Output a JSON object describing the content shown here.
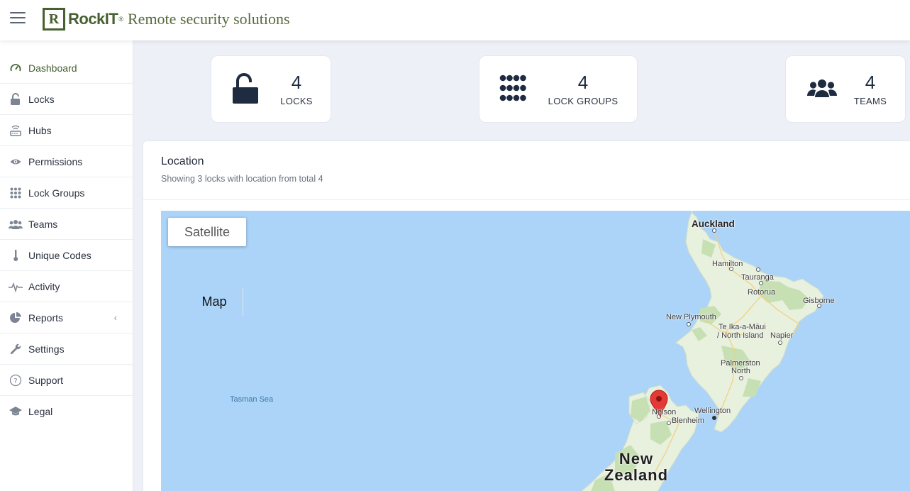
{
  "header": {
    "brand_letter": "R",
    "brand_name": "RockIT",
    "brand_reg": "®",
    "tagline": "Remote security solutions"
  },
  "sidebar": {
    "items": [
      {
        "label": "Dashboard",
        "icon": "speedometer-icon",
        "active": true
      },
      {
        "label": "Locks",
        "icon": "lock-icon"
      },
      {
        "label": "Hubs",
        "icon": "router-icon"
      },
      {
        "label": "Permissions",
        "icon": "eye-icon"
      },
      {
        "label": "Lock Groups",
        "icon": "grid-dots-icon"
      },
      {
        "label": "Teams",
        "icon": "users-icon"
      },
      {
        "label": "Unique Codes",
        "icon": "key-icon"
      },
      {
        "label": "Activity",
        "icon": "pulse-icon"
      },
      {
        "label": "Reports",
        "icon": "pie-chart-icon",
        "chevron": "‹"
      },
      {
        "label": "Settings",
        "icon": "wrench-icon"
      },
      {
        "label": "Support",
        "icon": "help-circle-icon"
      },
      {
        "label": "Legal",
        "icon": "graduation-cap-icon"
      }
    ]
  },
  "stats": {
    "locks": {
      "value": "4",
      "label": "LOCKS"
    },
    "lock_groups": {
      "value": "4",
      "label": "LOCK GROUPS"
    },
    "teams": {
      "value": "4",
      "label": "TEAMS"
    }
  },
  "location": {
    "title": "Location",
    "subtitle": "Showing 3 locks with location from total 4"
  },
  "map": {
    "type_buttons": {
      "map": "Map",
      "satellite": "Satellite"
    },
    "labels": {
      "auckland": "Auckland",
      "hamilton": "Hamilton",
      "tauranga": "Tauranga",
      "rotorua": "Rotorua",
      "gisborne": "Gisborne",
      "new_plymouth": "New Plymouth",
      "te_ika_1": "Te Ika-a-Māui",
      "te_ika_2": "/ North Island",
      "napier": "Napier",
      "palmerston_1": "Palmerston",
      "palmerston_2": "North",
      "wellington": "Wellington",
      "nelson": "Nelson",
      "blenheim": "Blenheim",
      "tasman_sea": "Tasman Sea",
      "country_1": "New",
      "country_2": "Zealand"
    },
    "colors": {
      "water": "#abd4f8",
      "land": "#e8f0de",
      "forest": "#c6e0b4",
      "marker": "#e53935"
    }
  },
  "colors": {
    "brand": "#466030",
    "accent_text": "#1e2b40"
  }
}
